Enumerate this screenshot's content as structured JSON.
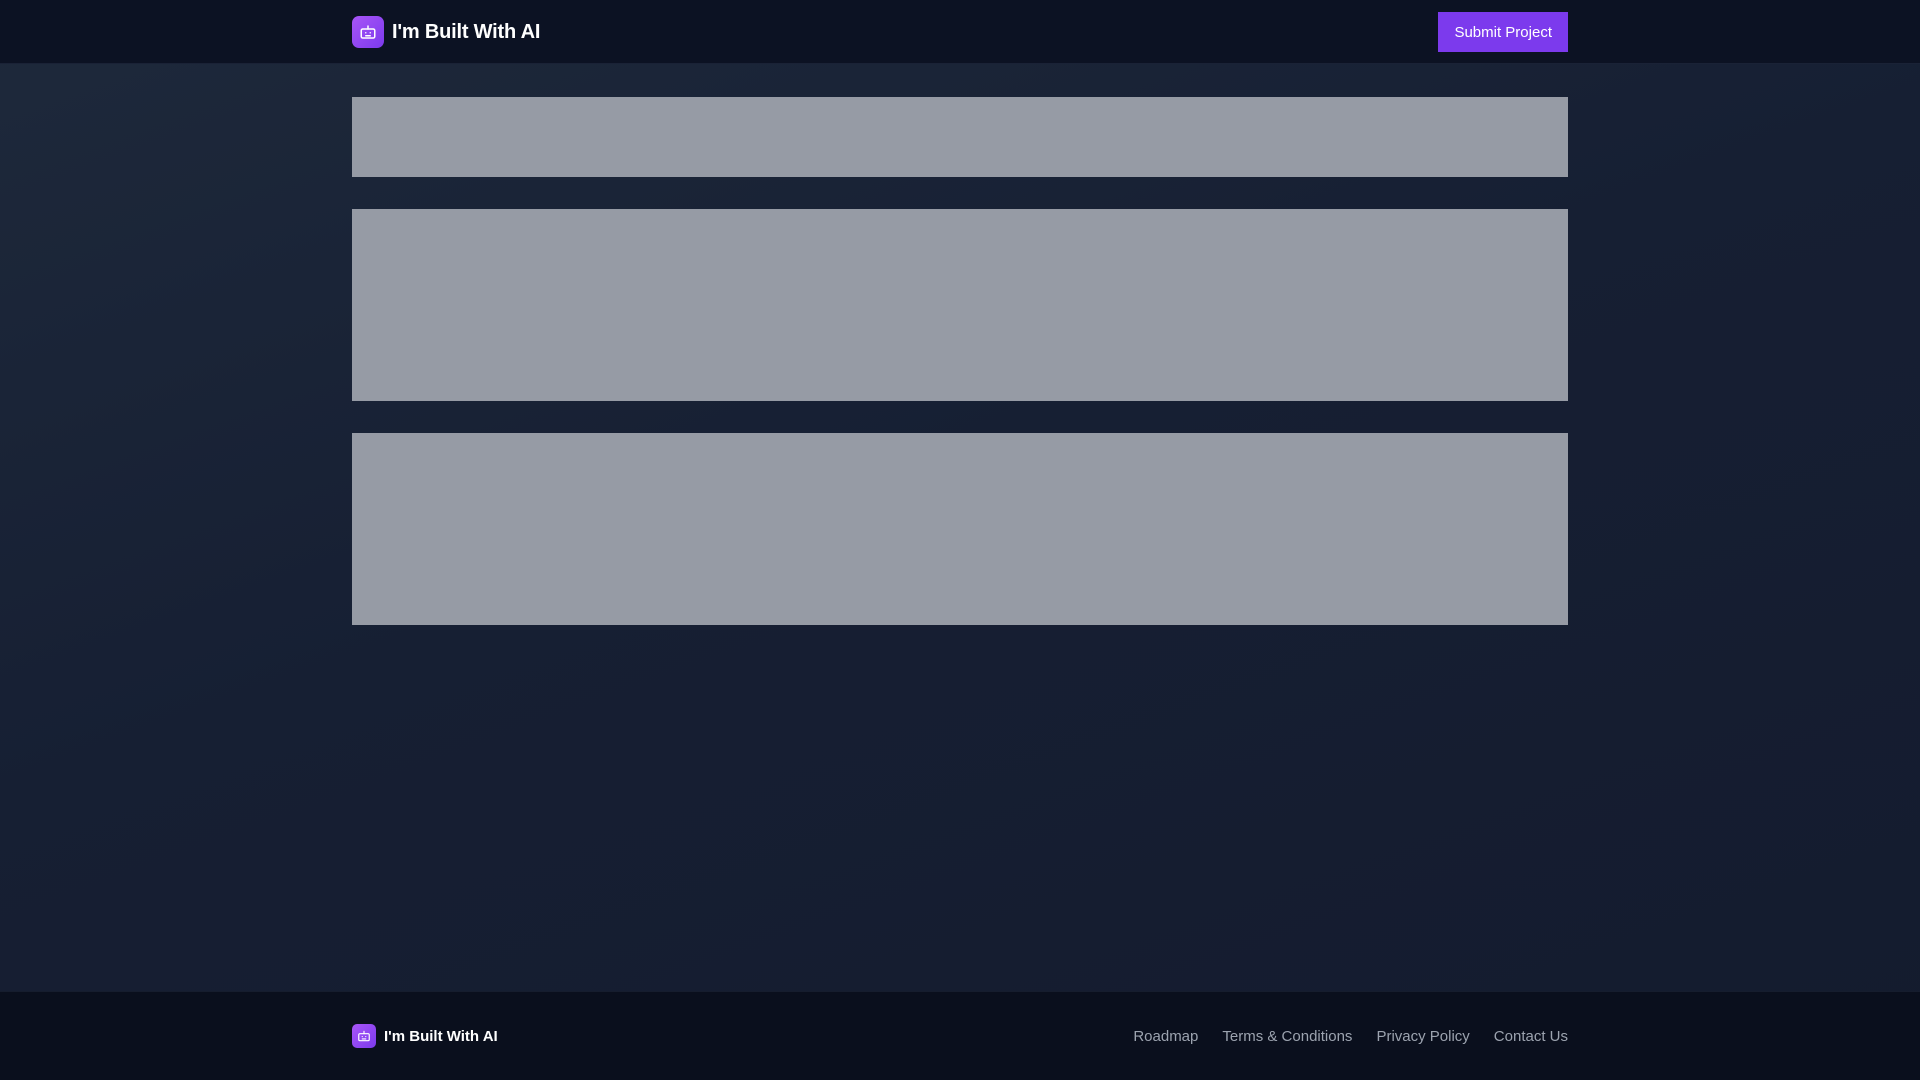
{
  "header": {
    "brand_title": "I'm Built With AI",
    "logo_icon": "robot-icon",
    "submit_label": "Submit Project"
  },
  "main": {
    "skeletons": [
      "loading-placeholder",
      "loading-placeholder",
      "loading-placeholder"
    ]
  },
  "footer": {
    "brand_title": "I'm Built With AI",
    "links": [
      {
        "label": "Roadmap"
      },
      {
        "label": "Terms & Conditions"
      },
      {
        "label": "Privacy Policy"
      },
      {
        "label": "Contact Us"
      }
    ]
  },
  "colors": {
    "accent": "#7c3aed",
    "header_bg": "#0c1223",
    "footer_bg": "#0a0f1d",
    "skeleton": "#969ba5"
  }
}
